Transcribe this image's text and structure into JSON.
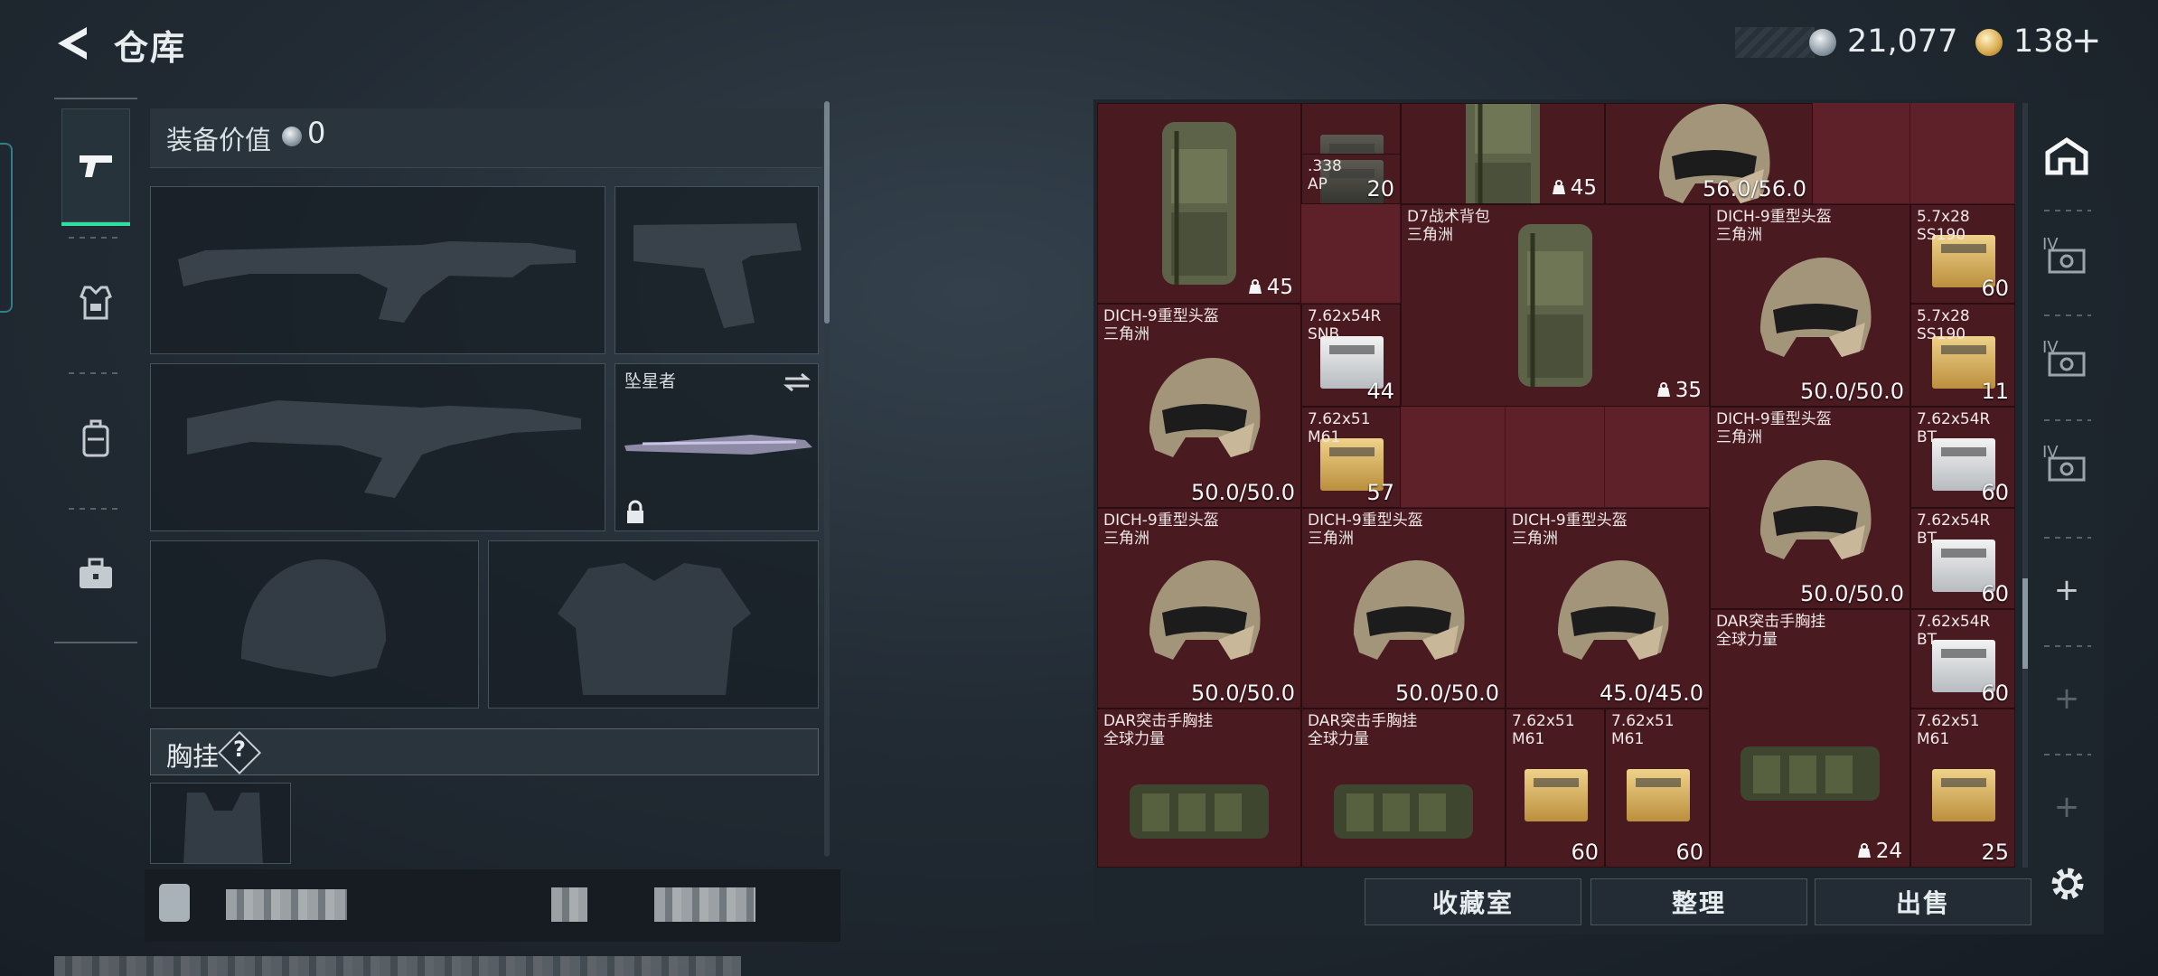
{
  "header": {
    "title": "仓库",
    "currency_1": "21,077",
    "currency_2": "138",
    "plus": "+"
  },
  "left_tabs": [
    {
      "name": "firearms",
      "icon": "pistol-icon",
      "active": true
    },
    {
      "name": "armor",
      "icon": "armor-vest-icon",
      "active": false
    },
    {
      "name": "backpack",
      "icon": "backpack-icon",
      "active": false
    },
    {
      "name": "toolbox",
      "icon": "briefcase-icon",
      "active": false
    }
  ],
  "loadout": {
    "value_label": "装备价值",
    "value": "0",
    "melee_name": "坠星者",
    "chest_label": "胸挂",
    "help": "?"
  },
  "warehouse": {
    "items": [
      {
        "id": "bp1",
        "name": "",
        "qty": "",
        "weight": "45"
      },
      {
        "id": "ammo1",
        "name": "",
        "qty": "20"
      },
      {
        "id": "ammo338",
        "name": ".338\nAP",
        "qty": "20"
      },
      {
        "id": "bp2",
        "name": "",
        "weight": "45"
      },
      {
        "id": "helm-top",
        "name": "",
        "durability": "56.0/56.0"
      },
      {
        "id": "d7",
        "name": "D7战术背包\n三角洲",
        "weight": "35"
      },
      {
        "id": "h1",
        "name": "DICH-9重型头盔\n三角洲",
        "durability": "50.0/50.0"
      },
      {
        "id": "a57a",
        "name": "5.7x28\nSS190",
        "qty": "60"
      },
      {
        "id": "h2",
        "name": "DICH-9重型头盔\n三角洲",
        "durability": "50.0/50.0"
      },
      {
        "id": "a762r1",
        "name": "7.62x54R\nSNB",
        "qty": "44"
      },
      {
        "id": "a57b",
        "name": "5.7x28\nSS190",
        "qty": "11"
      },
      {
        "id": "a762m1",
        "name": "7.62x51\nM61",
        "qty": "57"
      },
      {
        "id": "h3",
        "name": "DICH-9重型头盔\n三角洲",
        "durability": "50.0/50.0"
      },
      {
        "id": "a762rb1",
        "name": "7.62x54R\nBT",
        "qty": "60"
      },
      {
        "id": "h4",
        "name": "DICH-9重型头盔\n三角洲",
        "durability": "50.0/50.0"
      },
      {
        "id": "h5",
        "name": "DICH-9重型头盔\n三角洲",
        "durability": "50.0/50.0"
      },
      {
        "id": "h6",
        "name": "DICH-9重型头盔\n三角洲",
        "durability": "45.0/45.0"
      },
      {
        "id": "a762rb2",
        "name": "7.62x54R\nBT",
        "qty": "60"
      },
      {
        "id": "dar1",
        "name": "DAR突击手胸挂\n全球力量",
        "weight": "24"
      },
      {
        "id": "a762rb3",
        "name": "7.62x54R\nBT",
        "qty": "60"
      },
      {
        "id": "dar2",
        "name": "DAR突击手胸挂\n全球力量"
      },
      {
        "id": "dar3",
        "name": "DAR突击手胸挂\n全球力量"
      },
      {
        "id": "m61a",
        "name": "7.62x51\nM61",
        "qty": "60"
      },
      {
        "id": "m61b",
        "name": "7.62x51\nM61",
        "qty": "60"
      },
      {
        "id": "m61c",
        "name": "7.62x51\nM61",
        "qty": "25"
      }
    ],
    "side_labels": [
      "IV",
      "IV",
      "IV"
    ],
    "side_plus": [
      "+",
      "+",
      "+"
    ]
  },
  "actions": {
    "collection": "收藏室",
    "sort": "整理",
    "sell": "出售"
  },
  "colors": {
    "grid_bg": "#5e2129",
    "accent_green": "#2de0a2"
  }
}
